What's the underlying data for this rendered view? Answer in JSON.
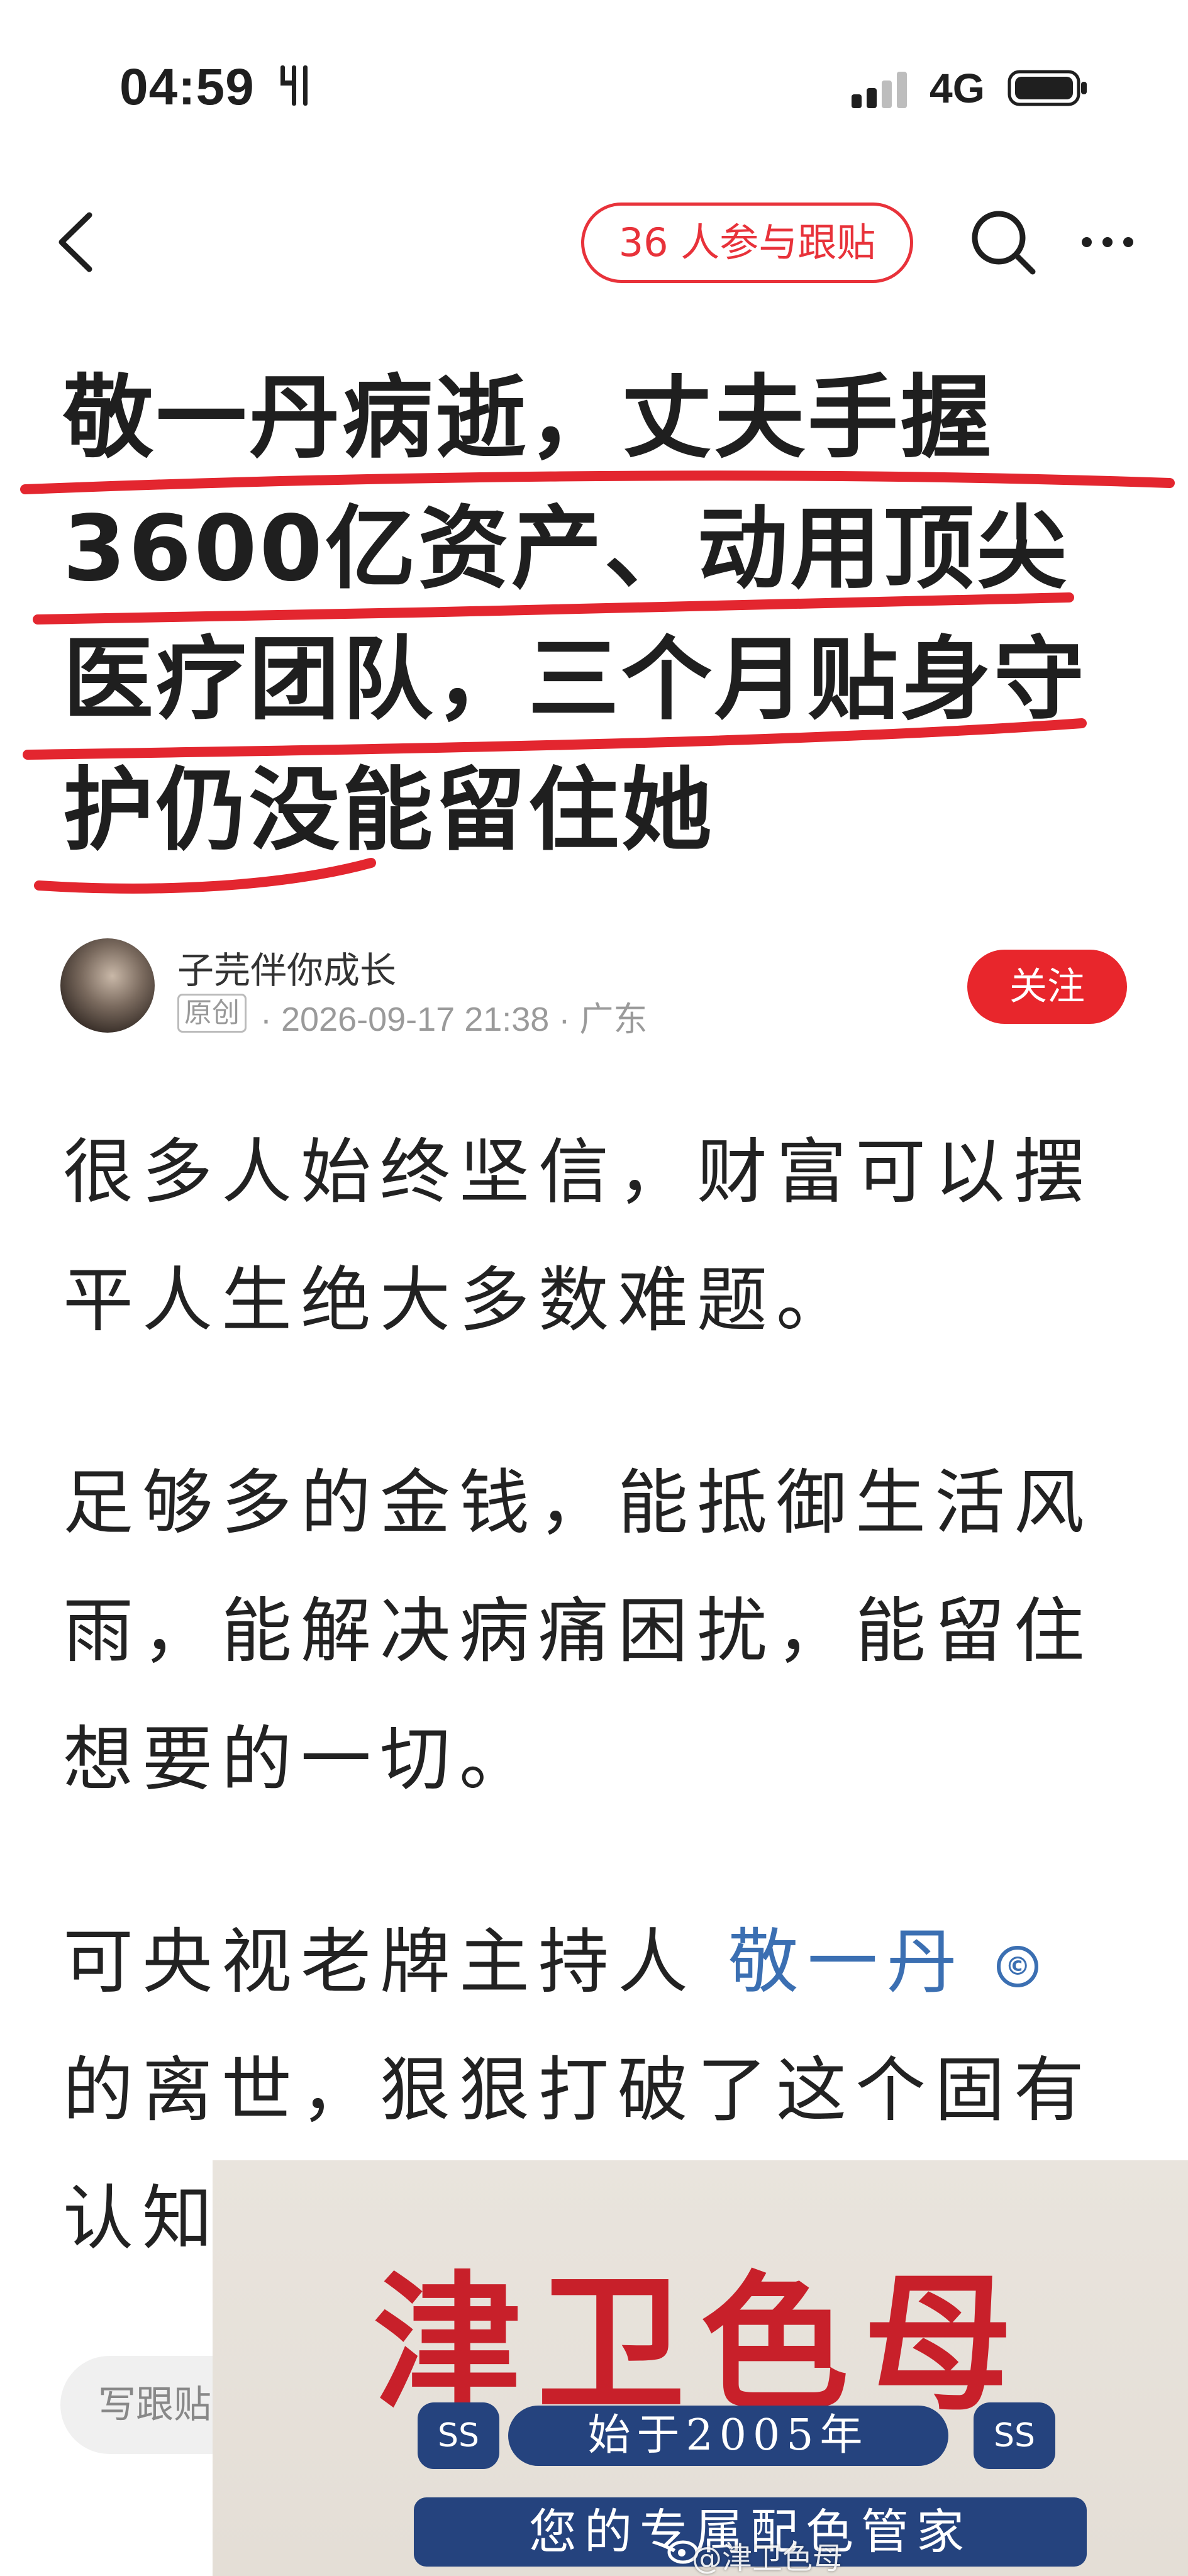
{
  "status_bar": {
    "time": "04:59",
    "network": "4G"
  },
  "nav": {
    "followers_pill": "36 人参与跟贴"
  },
  "article": {
    "title": "敬一丹病逝，丈夫手握3600亿资产、动用顶尖医疗团队，三个月贴身守护仍没能留住她",
    "author": "子芫伴你成长",
    "original_badge": "原创",
    "meta": "· 2026-09-17 21:38 · 广东",
    "follow_label": "关注",
    "paragraphs": {
      "p1": "很多人始终坚信，财富可以摆平人生绝大多数难题。",
      "p2": "足够多的金钱，能抵御生活风雨，能解决病痛困扰，能留住想要的一切。",
      "p3_before": "可央视老牌主持人 ",
      "p3_link": "敬一丹",
      "p3_badge": "©",
      "p3_after": " 的离世，狠狠打破了这个固有认知。"
    }
  },
  "comment_bar": {
    "placeholder": "写跟贴"
  },
  "ad": {
    "brand": "津卫色母",
    "since": "始于2005年",
    "ornament_left": "SS",
    "ornament_right": "SS",
    "tagline": "您的专属配色管家",
    "watermark": "@津卫色母"
  },
  "colors": {
    "accent_red": "#e8262c",
    "link_blue": "#3b6fb2",
    "ad_navy": "#25437e"
  }
}
